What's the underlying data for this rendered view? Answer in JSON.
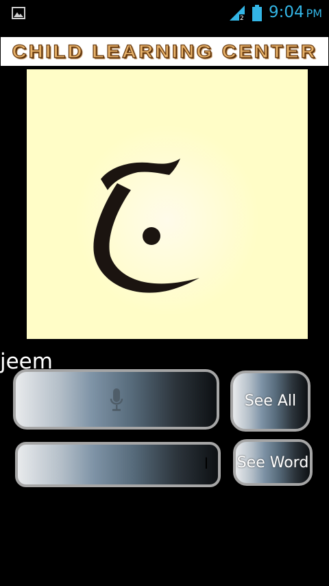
{
  "status_bar": {
    "time": "9:04",
    "ampm": "PM",
    "icons": [
      "gallery-icon",
      "signal-icon",
      "battery-icon"
    ]
  },
  "banner": {
    "title": "CHILD LEARNING CENTER"
  },
  "letter": {
    "glyph": "ج",
    "name": "jeem"
  },
  "record_field": {
    "icon": "mic-icon"
  },
  "answer_field": {
    "value": "ا"
  },
  "buttons": {
    "see_all": "See All",
    "see_word": "See Word"
  },
  "colors": {
    "clock": "#33b5e5",
    "card_background": "#fffdc7",
    "banner_text": "#e7b26a",
    "button_border": "#a6a6a6"
  }
}
